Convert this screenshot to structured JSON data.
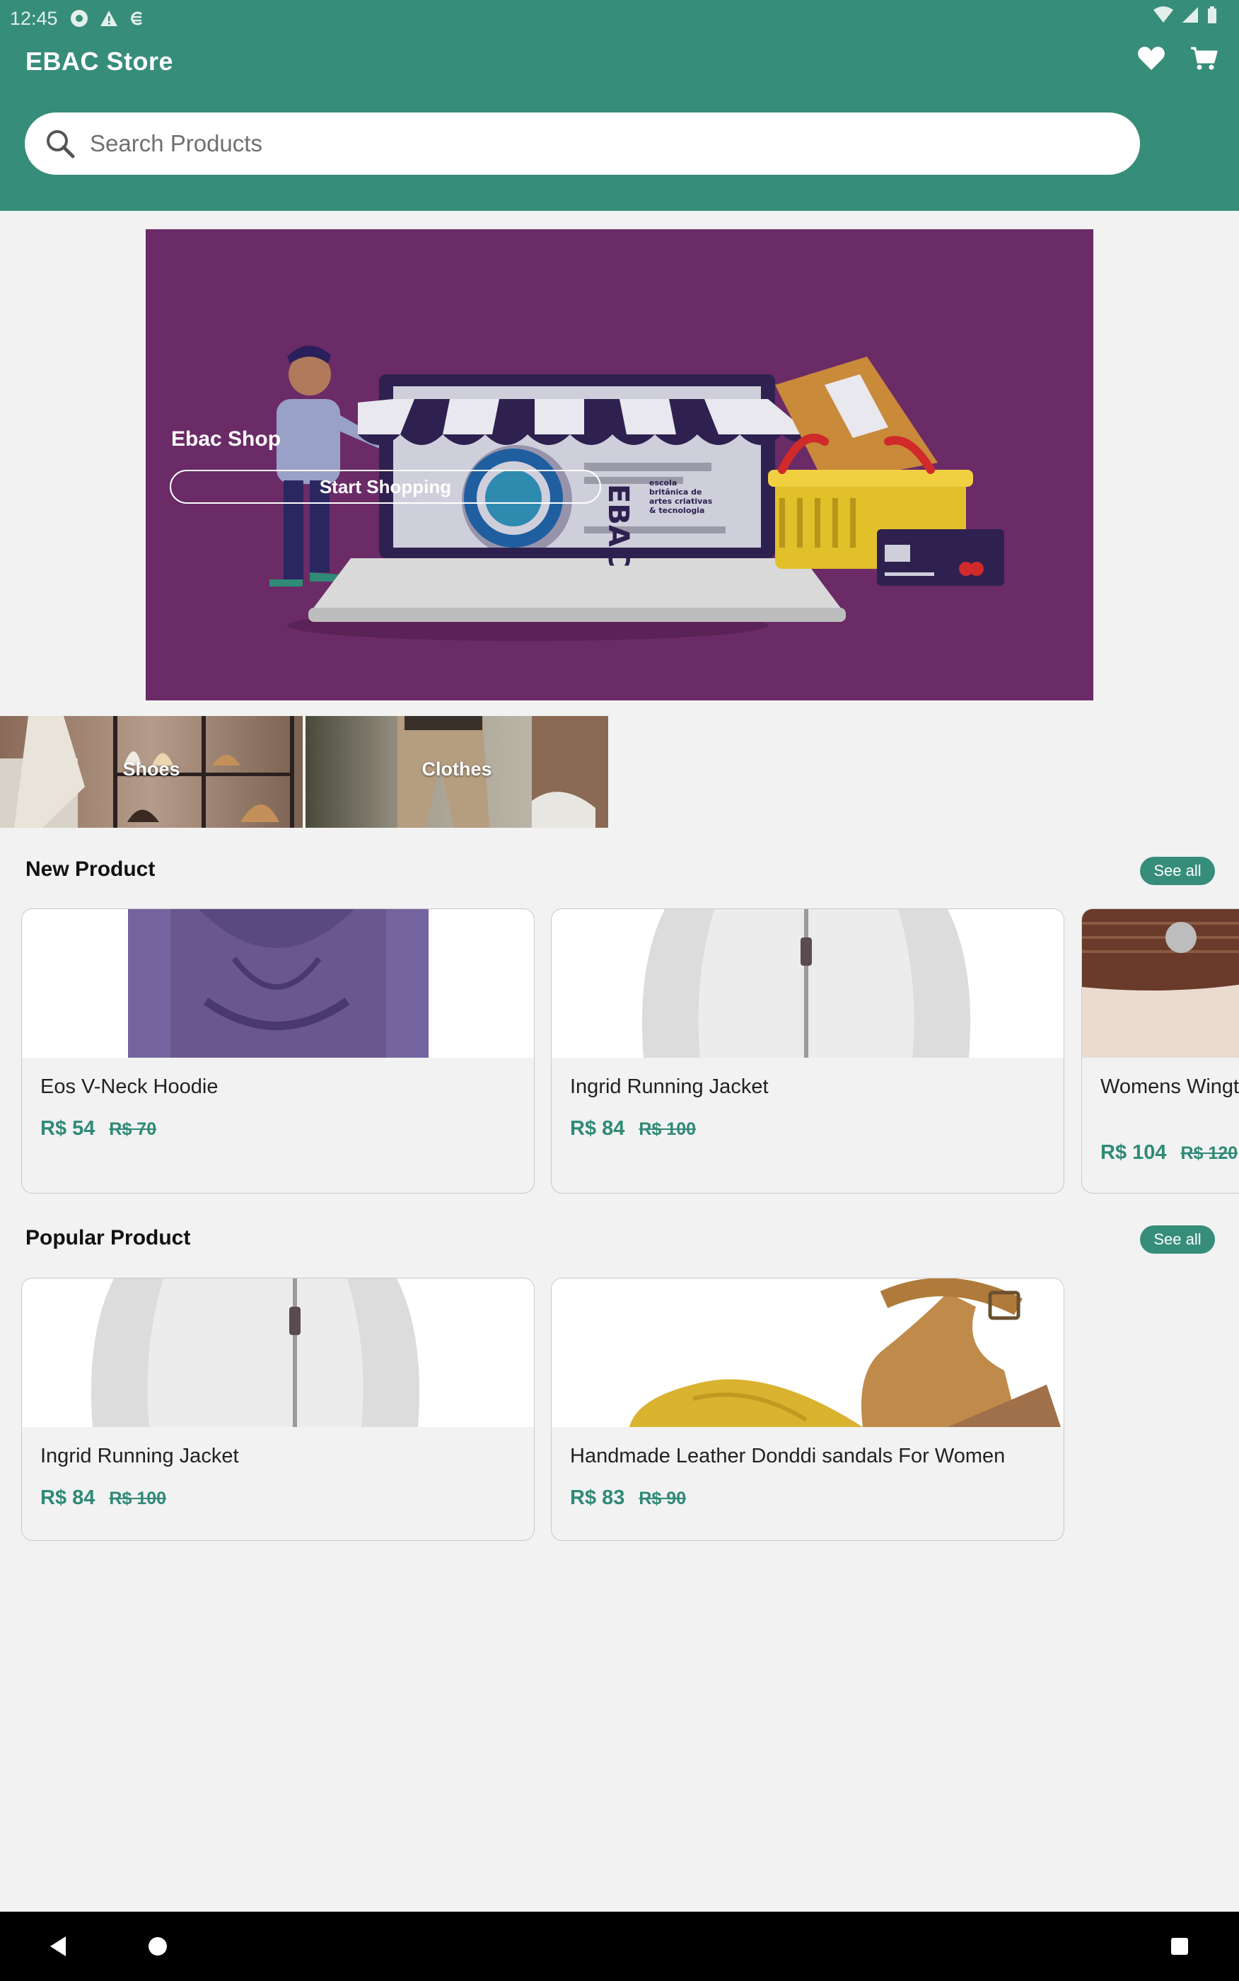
{
  "status_bar": {
    "time": "12:45"
  },
  "app": {
    "title": "EBAC Store"
  },
  "search": {
    "placeholder": "Search Products"
  },
  "banner": {
    "title": "Ebac Shop",
    "button_label": "Start Shopping",
    "logo_text": "EBAC",
    "logo_caption": "escola britânica de artes criativas & tecnologia"
  },
  "categories": [
    {
      "label": "Shoes"
    },
    {
      "label": "Clothes"
    }
  ],
  "new_products": {
    "title": "New Product",
    "see_all": "See all",
    "items": [
      {
        "name": "Eos V-Neck Hoodie",
        "price": "R$ 54",
        "old_price": "R$ 70"
      },
      {
        "name": "Ingrid Running Jacket",
        "price": "R$ 84",
        "old_price": "R$ 100"
      },
      {
        "name": "Womens Wingtip Lace Up Full Brogues Oxfords",
        "price": "R$ 104",
        "old_price": "R$ 120"
      }
    ]
  },
  "popular_products": {
    "title": "Popular Product",
    "see_all": "See all",
    "items": [
      {
        "name": "Ingrid Running Jacket",
        "price": "R$ 84",
        "old_price": "R$ 100"
      },
      {
        "name": "Handmade Leather Donddi sandals For Women",
        "price": "R$ 83",
        "old_price": "R$ 90"
      }
    ]
  },
  "colors": {
    "primary": "#368d7a",
    "banner": "#6a2b67",
    "background": "#f2f2f2"
  }
}
